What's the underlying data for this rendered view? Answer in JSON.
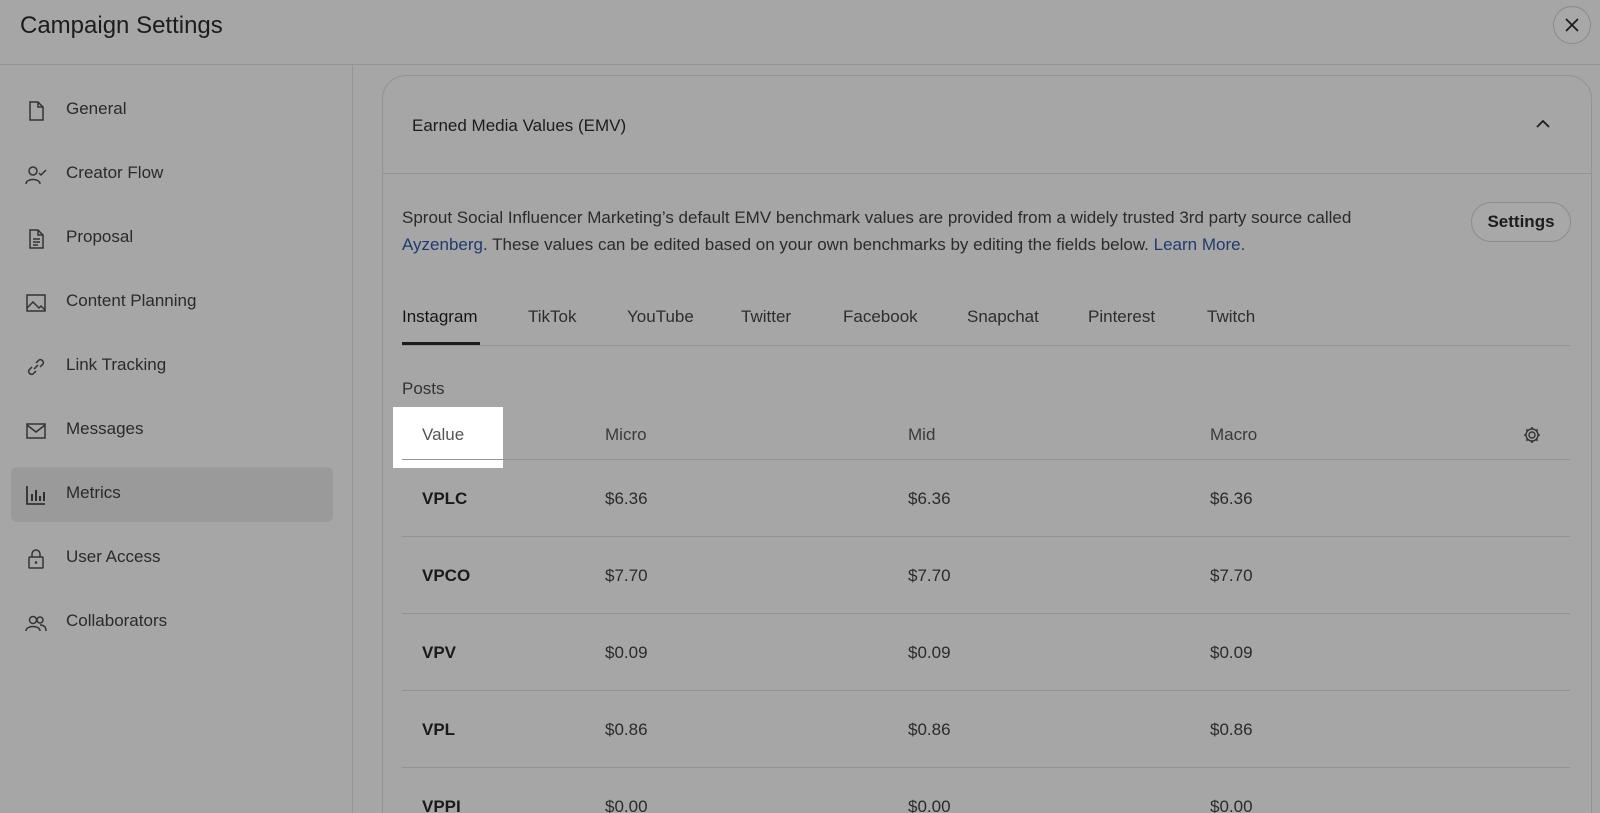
{
  "header": {
    "title": "Campaign Settings"
  },
  "sidebar": {
    "items": [
      {
        "label": "General",
        "icon": "document-icon"
      },
      {
        "label": "Creator Flow",
        "icon": "user-check-icon"
      },
      {
        "label": "Proposal",
        "icon": "file-text-icon"
      },
      {
        "label": "Content Planning",
        "icon": "image-icon"
      },
      {
        "label": "Link Tracking",
        "icon": "link-icon"
      },
      {
        "label": "Messages",
        "icon": "mail-icon"
      },
      {
        "label": "Metrics",
        "icon": "bar-chart-icon",
        "active": true
      },
      {
        "label": "User Access",
        "icon": "lock-icon"
      },
      {
        "label": "Collaborators",
        "icon": "users-icon"
      }
    ]
  },
  "section": {
    "title": "Earned Media Values (EMV)",
    "description_part1": "Sprout Social Influencer Marketing’s default EMV benchmark values are provided from a widely trusted 3rd party source called ",
    "description_link": "Ayzenberg",
    "description_part2": ". These values can be edited based on your own benchmarks by editing the fields below. ",
    "learn_more": "Learn More.",
    "settings_label": "Settings"
  },
  "tabs": [
    "Instagram",
    "TikTok",
    "YouTube",
    "Twitter",
    "Facebook",
    "Snapchat",
    "Pinterest",
    "Twitch"
  ],
  "table": {
    "section_label": "Posts",
    "columns": [
      "Value",
      "Micro",
      "Mid",
      "Macro"
    ],
    "rows": [
      {
        "metric": "VPLC",
        "micro": "$6.36",
        "mid": "$6.36",
        "macro": "$6.36"
      },
      {
        "metric": "VPCO",
        "micro": "$7.70",
        "mid": "$7.70",
        "macro": "$7.70"
      },
      {
        "metric": "VPV",
        "micro": "$0.09",
        "mid": "$0.09",
        "macro": "$0.09"
      },
      {
        "metric": "VPL",
        "micro": "$0.86",
        "mid": "$0.86",
        "macro": "$0.86"
      },
      {
        "metric": "VPPI",
        "micro": "$0.00",
        "mid": "$0.00",
        "macro": "$0.00"
      }
    ]
  },
  "colors": {
    "link": "#213a6e",
    "overlay": "#a6a6a6",
    "highlight": "#ffffff"
  }
}
